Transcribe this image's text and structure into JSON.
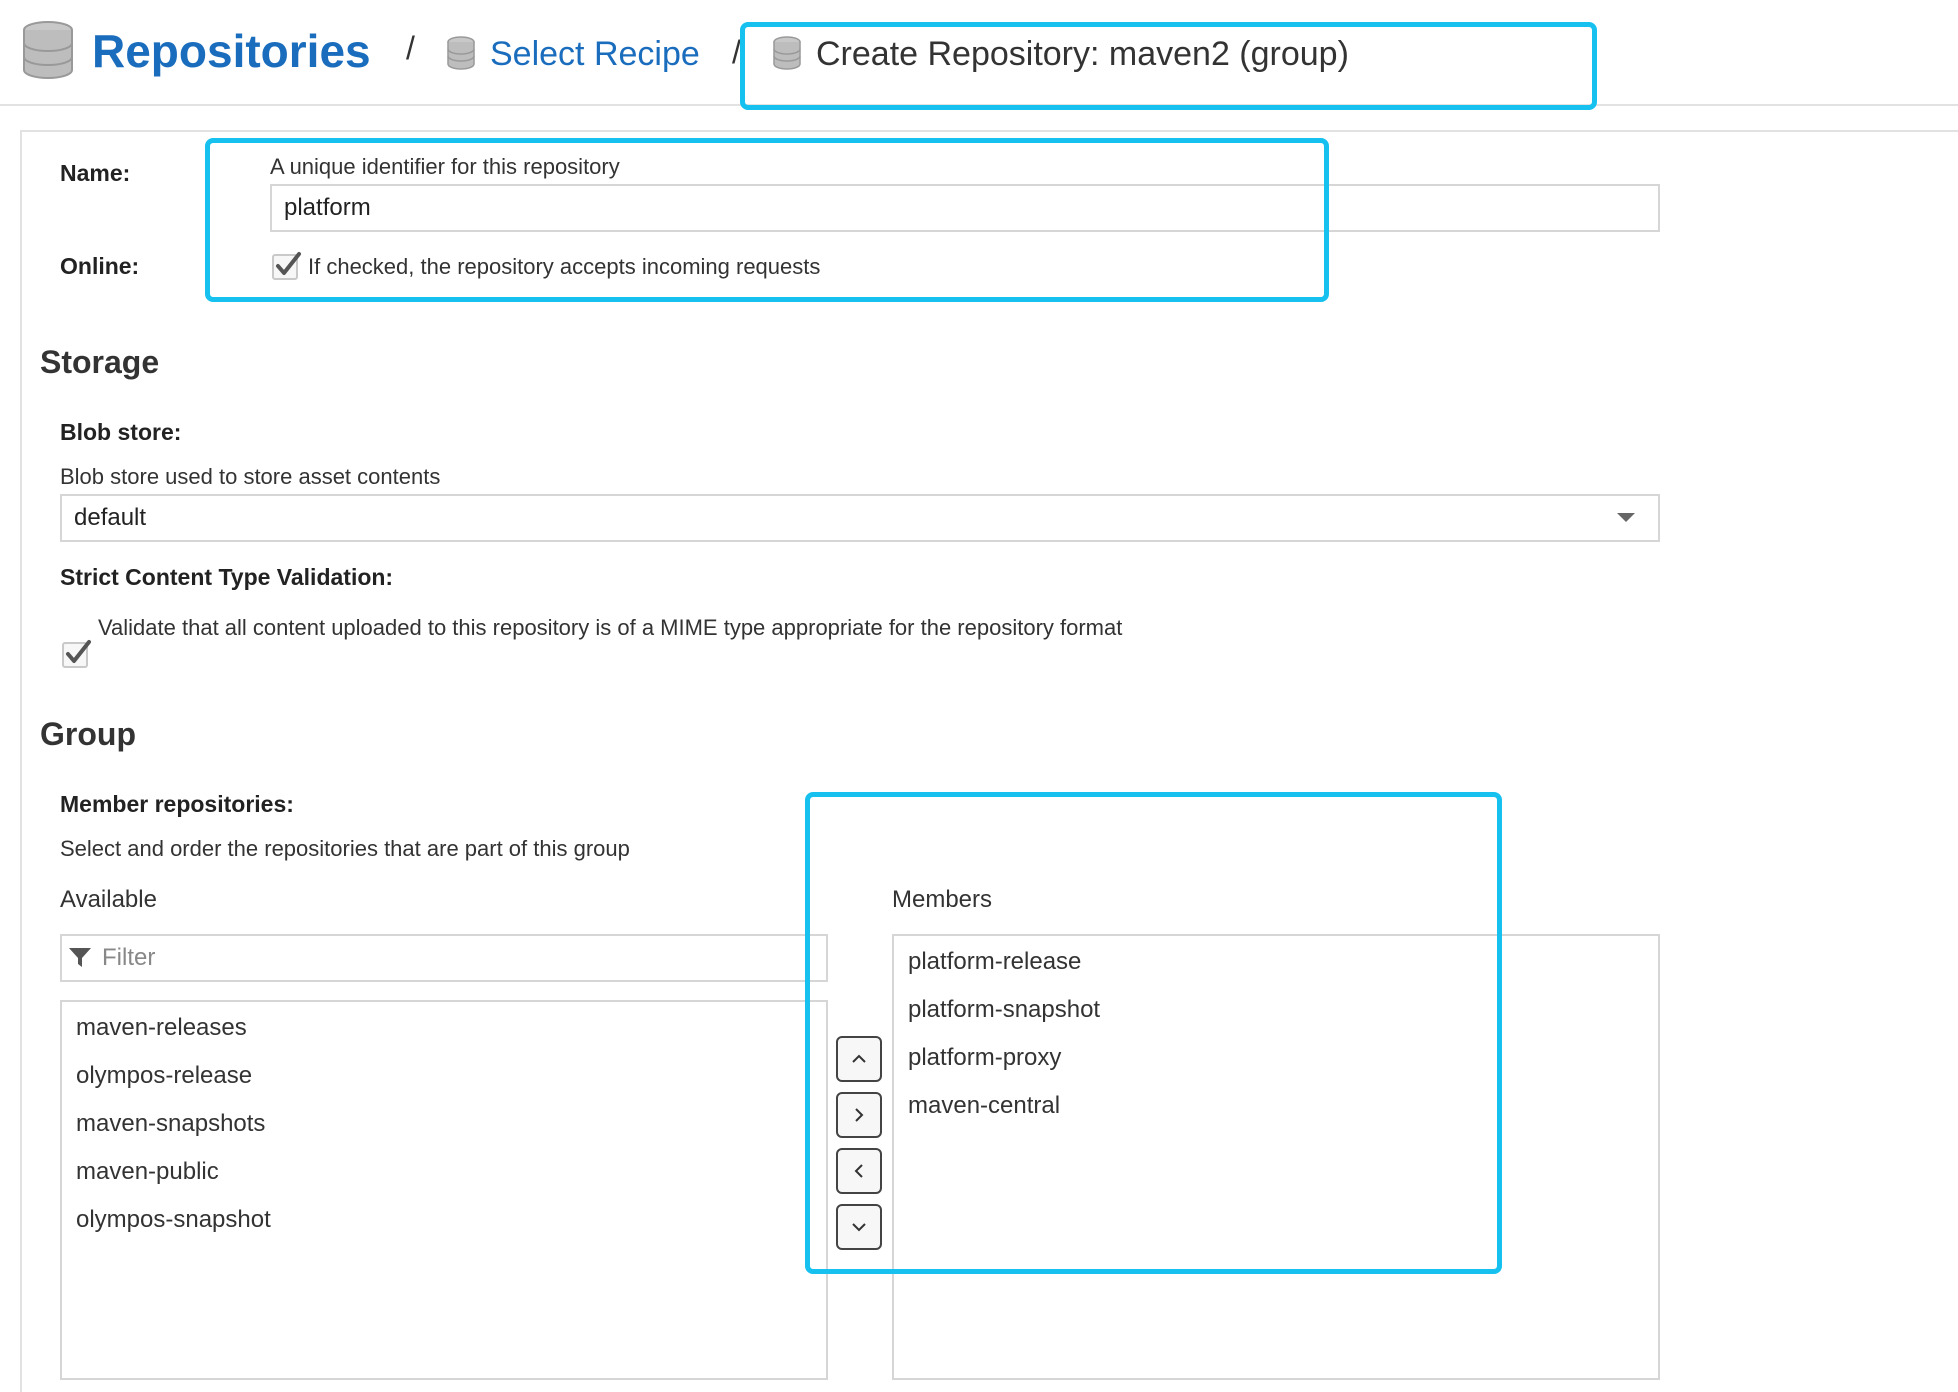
{
  "breadcrumb": {
    "root": "Repositories",
    "separator": "/",
    "link": "Select Recipe",
    "current": "Create Repository: maven2 (group)"
  },
  "form": {
    "name": {
      "label": "Name:",
      "hint": "A unique identifier for this repository",
      "value": "platform"
    },
    "online": {
      "label": "Online:",
      "checked": true,
      "description": "If checked, the repository accepts incoming requests"
    }
  },
  "storage": {
    "title": "Storage",
    "blob_store": {
      "label": "Blob store:",
      "hint": "Blob store used to store asset contents",
      "value": "default"
    },
    "strict_validation": {
      "label": "Strict Content Type Validation:",
      "checked": true,
      "description": "Validate that all content uploaded to this repository is of a MIME type appropriate for the repository format"
    }
  },
  "group": {
    "title": "Group",
    "members_label": "Member repositories:",
    "hint": "Select and order the repositories that are part of this group",
    "available_label": "Available",
    "members_header": "Members",
    "filter_placeholder": "Filter",
    "available": [
      "maven-releases",
      "olympos-release",
      "maven-snapshots",
      "maven-public",
      "olympos-snapshot"
    ],
    "members": [
      "platform-release",
      "platform-snapshot",
      "platform-proxy",
      "maven-central"
    ]
  },
  "icons": {
    "database": "database-icon",
    "filter": "filter-icon",
    "check": "check-icon",
    "dropdown": "caret-down-icon",
    "up": "chevron-up-icon",
    "right": "chevron-right-icon",
    "left": "chevron-left-icon",
    "down": "chevron-down-icon"
  },
  "colors": {
    "link": "#1a6dbd",
    "highlight": "#16c1f0"
  }
}
